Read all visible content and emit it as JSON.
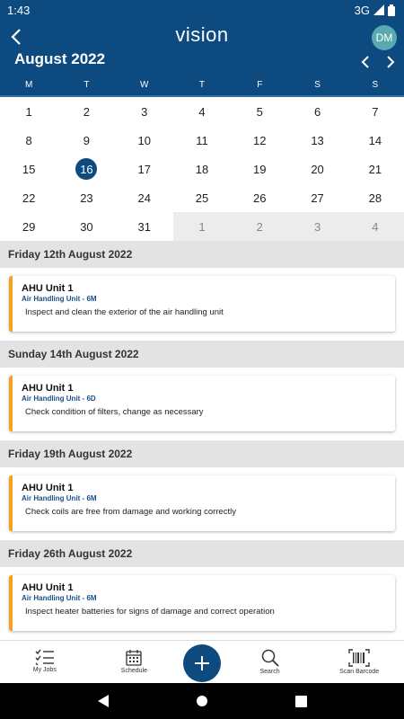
{
  "status": {
    "time": "1:43",
    "network": "3G"
  },
  "header": {
    "logo": "vision",
    "avatar": "DM",
    "month": "August 2022"
  },
  "weekdays": [
    "M",
    "T",
    "W",
    "T",
    "F",
    "S",
    "S"
  ],
  "calendar": [
    [
      "1",
      "2",
      "3",
      "4",
      "5",
      "6",
      "7"
    ],
    [
      "8",
      "9",
      "10",
      "11",
      "12",
      "13",
      "14"
    ],
    [
      "15",
      "16",
      "17",
      "18",
      "19",
      "20",
      "21"
    ],
    [
      "22",
      "23",
      "24",
      "25",
      "26",
      "27",
      "28"
    ],
    [
      "29",
      "30",
      "31",
      "1",
      "2",
      "3",
      "4"
    ]
  ],
  "today": "16",
  "jobs": [
    {
      "date": "Friday 12th August 2022",
      "title": "AHU Unit 1",
      "subtitle": "Air Handling Unit - 6M",
      "desc": "Inspect and clean the exterior of the air handling unit"
    },
    {
      "date": "Sunday 14th August 2022",
      "title": "AHU Unit 1",
      "subtitle": "Air Handling Unit - 6D",
      "desc": "Check condition of filters, change as necessary"
    },
    {
      "date": "Friday 19th August 2022",
      "title": "AHU Unit 1",
      "subtitle": "Air Handling Unit - 6M",
      "desc": "Check coils are free from damage and working correctly"
    },
    {
      "date": "Friday 26th August 2022",
      "title": "AHU Unit 1",
      "subtitle": "Air Handling Unit - 6M",
      "desc": "Inspect heater batteries for signs of damage and correct operation"
    }
  ],
  "tabs": {
    "my_jobs": "My Jobs",
    "schedule": "Schedule",
    "search": "Search",
    "scan": "Scan Barcode"
  },
  "colors": {
    "primary": "#0c4a80",
    "accent": "#f1a31d"
  }
}
